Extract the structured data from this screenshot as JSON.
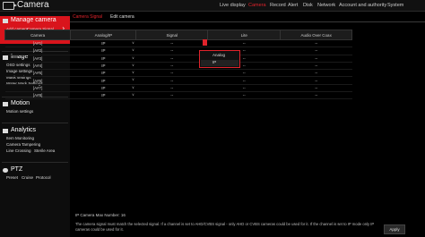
{
  "header": {
    "title": "Camera",
    "nav": [
      "Live display",
      "Camera",
      "Record",
      "Alert",
      "Disk",
      "Network",
      "Account and authority",
      "System"
    ],
    "active_nav": "Camera"
  },
  "sidebar": {
    "sections": [
      {
        "title": "Manage camera",
        "items": [
          "Add camera",
          "Camera Signal",
          "Edit camera"
        ]
      },
      {
        "title": "Image",
        "items": [
          "OSD settings",
          "Image settings",
          "Mask settings",
          "Water Mark Settings"
        ]
      },
      {
        "title": "Motion",
        "items": [
          "Motion settings"
        ]
      },
      {
        "title": "Analytics",
        "items": [
          "Item Monitoring",
          "Camera Tampering",
          "Line Crossing",
          "Sterile Area"
        ]
      },
      {
        "title": "PTZ",
        "items": [
          "Preset",
          "Cruise",
          "Protocol"
        ]
      }
    ]
  },
  "tabs": [
    "Camera Signal",
    "Edit camera"
  ],
  "table": {
    "headers": [
      "Camera",
      "Analog/IP",
      "Signal",
      "Lite",
      "Audio Over Coax"
    ],
    "rows": [
      [
        "[A#1]",
        "IP",
        "--",
        "--",
        "--"
      ],
      [
        "[A#2]",
        "IP",
        "--",
        "--",
        "--"
      ],
      [
        "[A#3]",
        "IP",
        "--",
        "--",
        "--"
      ],
      [
        "[A#4]",
        "IP",
        "--",
        "--",
        "--"
      ],
      [
        "[A#5]",
        "IP",
        "--",
        "--",
        "--"
      ],
      [
        "[A#6]",
        "IP",
        "--",
        "--",
        "--"
      ],
      [
        "[A#7]",
        "IP",
        "--",
        "--",
        "--"
      ],
      [
        "[A#8]",
        "IP",
        "--",
        "--",
        "--"
      ]
    ]
  },
  "dropdown": {
    "options": [
      "Analog",
      "IP"
    ]
  },
  "footer": {
    "max_number": "IP Camera Max Number: 16",
    "note": "The camera signal must match the selected signal. If a channel is set to AHD/CVBS signal - only AHD or CVBS cameras could be used for it. If the channel is set to IP mode only IP cameras could be used for it.",
    "apply_label": "Apply"
  },
  "colors": {
    "accent": "#e0232b",
    "background": "#000000"
  }
}
